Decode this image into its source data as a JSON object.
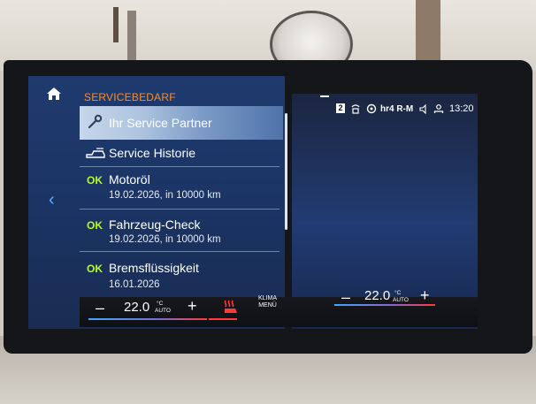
{
  "header": {
    "section_title": "SERVICEBEDARF"
  },
  "menu": {
    "partner_label": "Ihr Service Partner",
    "history_label": "Service Historie"
  },
  "service_items": [
    {
      "status": "OK",
      "label": "Motoröl",
      "detail": "19.02.2026, in 10000 km"
    },
    {
      "status": "OK",
      "label": "Fahrzeug-Check",
      "detail": "19.02.2026, in 10000 km"
    },
    {
      "status": "OK",
      "label": "Bremsflüssigkeit",
      "detail": "16.01.2026"
    }
  ],
  "status_bar": {
    "badge": "2",
    "radio": "hr4 R-M",
    "time": "13:20"
  },
  "climate": {
    "minus": "–",
    "plus": "+",
    "left_temp": "22.0",
    "right_temp": "22.0",
    "unit": "°C",
    "auto": "AUTO",
    "klima_line1": "KLIMA",
    "klima_line2": "MENÜ"
  },
  "colors": {
    "accent_orange": "#ff8c24",
    "ok_green": "#b6ff1a",
    "back_blue": "#4fb7ff"
  }
}
